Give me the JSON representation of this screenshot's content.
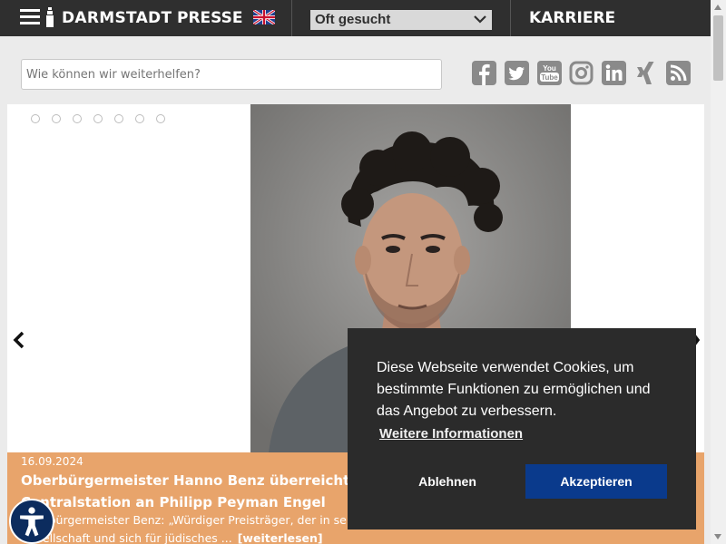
{
  "header": {
    "brand": "DARMSTADT",
    "presse": "PRESSE",
    "oft_gesucht": "Oft gesucht",
    "karriere": "KARRIERE"
  },
  "search": {
    "placeholder": "Wie können wir weiterhelfen?"
  },
  "social_icons": [
    "facebook-icon",
    "twitter-icon",
    "youtube-icon",
    "instagram-icon",
    "linkedin-icon",
    "xing-icon",
    "rss-icon"
  ],
  "slider": {
    "dot_count": 7,
    "date": "16.09.2024",
    "title_line1": "Oberbürgermeister Hanno Benz überreicht Rica",
    "title_line2": "Centralstation an Philipp Peyman Engel",
    "text_line1": "Oberbürgermeister Benz: „Würdiger Preisträger, der in se",
    "text_line2": "Gesellschaft und sich für jüdisches ...",
    "more": "[weiterlesen]"
  },
  "cookie": {
    "message": "Diese Webseite verwendet Cookies, um bestimmte Funktionen zu ermöglichen und das Angebot zu verbessern.",
    "link": "Weitere Informationen",
    "decline": "Ablehnen",
    "accept": "Akzeptieren"
  },
  "colors": {
    "topbar": "#2f2f2f",
    "caption_bg": "#e8a46b",
    "accept_btn": "#0a3a8c",
    "social_icon": "#8a8a8a"
  }
}
